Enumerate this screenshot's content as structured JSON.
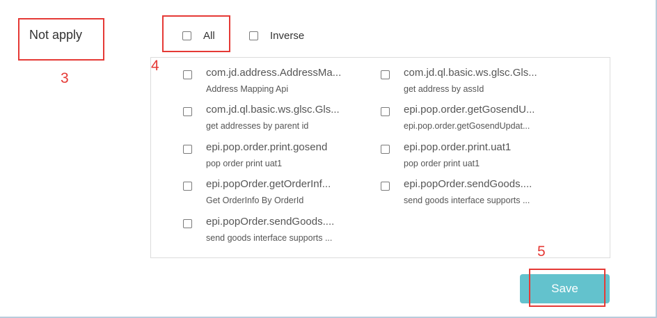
{
  "not_apply": {
    "label": "Not apply"
  },
  "select": {
    "all_label": "All",
    "inverse_label": "Inverse"
  },
  "apis": [
    {
      "name": "com.jd.address.AddressMa...",
      "desc": "Address Mapping Api"
    },
    {
      "name": "com.jd.ql.basic.ws.glsc.Gls...",
      "desc": "get address by assId"
    },
    {
      "name": "com.jd.ql.basic.ws.glsc.Gls...",
      "desc": "get addresses by parent id"
    },
    {
      "name": "epi.pop.order.getGosendU...",
      "desc": "epi.pop.order.getGosendUpdat..."
    },
    {
      "name": "epi.pop.order.print.gosend",
      "desc": "pop order print uat1"
    },
    {
      "name": "epi.pop.order.print.uat1",
      "desc": "pop order print uat1"
    },
    {
      "name": "epi.popOrder.getOrderInf...",
      "desc": "Get OrderInfo By OrderId"
    },
    {
      "name": "epi.popOrder.sendGoods....",
      "desc": "send goods interface supports ..."
    },
    {
      "name": "epi.popOrder.sendGoods....",
      "desc": "send goods interface supports ..."
    }
  ],
  "save": {
    "label": "Save"
  },
  "annotations": {
    "n3": "3",
    "n4": "4",
    "n5": "5",
    "color": "#e53935"
  },
  "colors": {
    "button": "#63c2cd",
    "annotation": "#e53935"
  }
}
